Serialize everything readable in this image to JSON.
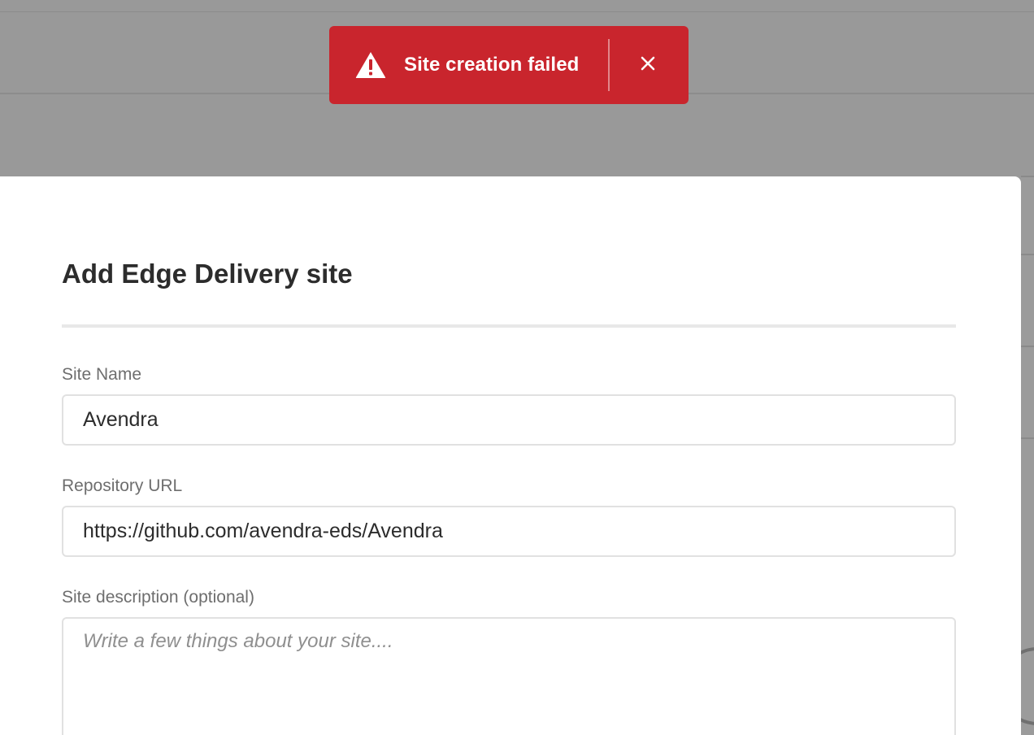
{
  "toast": {
    "variant": "negative",
    "color": "#c9252d",
    "icon": "alert-triangle-icon",
    "message": "Site creation failed",
    "close_icon": "close-icon"
  },
  "dialog": {
    "title": "Add Edge Delivery site",
    "fields": {
      "site_name": {
        "label": "Site Name",
        "value": "Avendra"
      },
      "repository_url": {
        "label": "Repository URL",
        "value": "https://github.com/avendra-eds/Avendra"
      },
      "description": {
        "label": "Site description (optional)",
        "value": "",
        "placeholder": "Write a few things about your site...."
      }
    }
  }
}
